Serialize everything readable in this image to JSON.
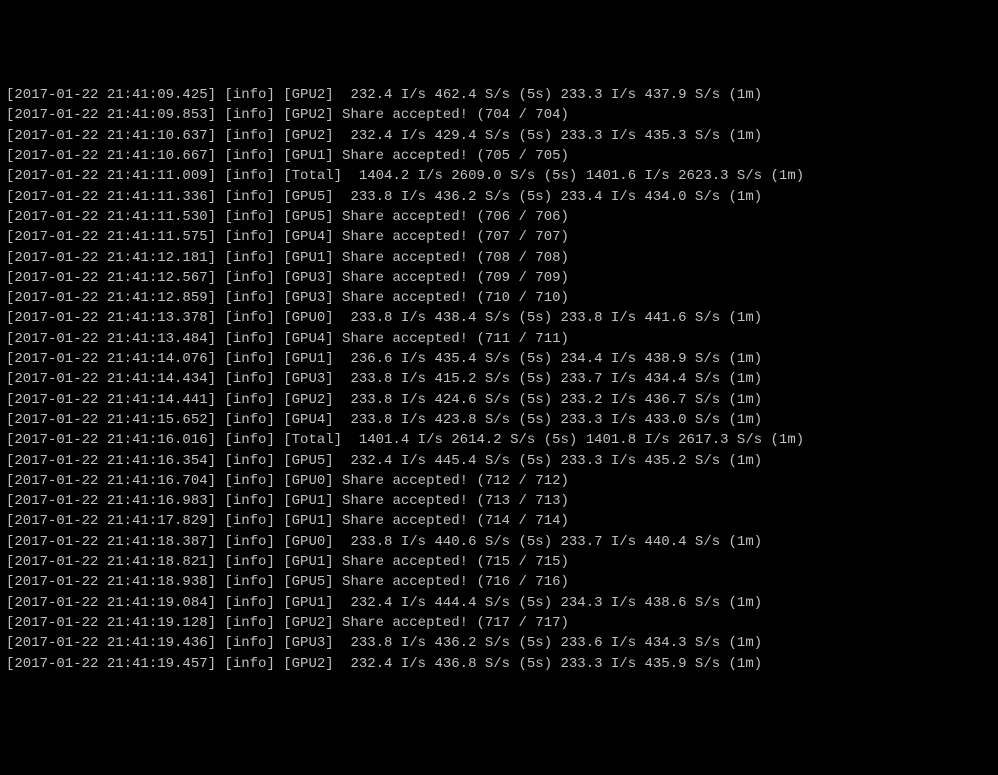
{
  "log_lines": [
    "[2017-01-22 21:41:09.425] [info] [GPU2]  232.4 I/s 462.4 S/s (5s) 233.3 I/s 437.9 S/s (1m)",
    "[2017-01-22 21:41:09.853] [info] [GPU2] Share accepted! (704 / 704)",
    "[2017-01-22 21:41:10.637] [info] [GPU2]  232.4 I/s 429.4 S/s (5s) 233.3 I/s 435.3 S/s (1m)",
    "[2017-01-22 21:41:10.667] [info] [GPU1] Share accepted! (705 / 705)",
    "[2017-01-22 21:41:11.009] [info] [Total]  1404.2 I/s 2609.0 S/s (5s) 1401.6 I/s 2623.3 S/s (1m)",
    "[2017-01-22 21:41:11.336] [info] [GPU5]  233.8 I/s 436.2 S/s (5s) 233.4 I/s 434.0 S/s (1m)",
    "[2017-01-22 21:41:11.530] [info] [GPU5] Share accepted! (706 / 706)",
    "[2017-01-22 21:41:11.575] [info] [GPU4] Share accepted! (707 / 707)",
    "[2017-01-22 21:41:12.181] [info] [GPU1] Share accepted! (708 / 708)",
    "[2017-01-22 21:41:12.567] [info] [GPU3] Share accepted! (709 / 709)",
    "[2017-01-22 21:41:12.859] [info] [GPU3] Share accepted! (710 / 710)",
    "[2017-01-22 21:41:13.378] [info] [GPU0]  233.8 I/s 438.4 S/s (5s) 233.8 I/s 441.6 S/s (1m)",
    "[2017-01-22 21:41:13.484] [info] [GPU4] Share accepted! (711 / 711)",
    "[2017-01-22 21:41:14.076] [info] [GPU1]  236.6 I/s 435.4 S/s (5s) 234.4 I/s 438.9 S/s (1m)",
    "[2017-01-22 21:41:14.434] [info] [GPU3]  233.8 I/s 415.2 S/s (5s) 233.7 I/s 434.4 S/s (1m)",
    "[2017-01-22 21:41:14.441] [info] [GPU2]  233.8 I/s 424.6 S/s (5s) 233.2 I/s 436.7 S/s (1m)",
    "[2017-01-22 21:41:15.652] [info] [GPU4]  233.8 I/s 423.8 S/s (5s) 233.3 I/s 433.0 S/s (1m)",
    "[2017-01-22 21:41:16.016] [info] [Total]  1401.4 I/s 2614.2 S/s (5s) 1401.8 I/s 2617.3 S/s (1m)",
    "[2017-01-22 21:41:16.354] [info] [GPU5]  232.4 I/s 445.4 S/s (5s) 233.3 I/s 435.2 S/s (1m)",
    "[2017-01-22 21:41:16.704] [info] [GPU0] Share accepted! (712 / 712)",
    "[2017-01-22 21:41:16.983] [info] [GPU1] Share accepted! (713 / 713)",
    "[2017-01-22 21:41:17.829] [info] [GPU1] Share accepted! (714 / 714)",
    "[2017-01-22 21:41:18.387] [info] [GPU0]  233.8 I/s 440.6 S/s (5s) 233.7 I/s 440.4 S/s (1m)",
    "[2017-01-22 21:41:18.821] [info] [GPU1] Share accepted! (715 / 715)",
    "[2017-01-22 21:41:18.938] [info] [GPU5] Share accepted! (716 / 716)",
    "[2017-01-22 21:41:19.084] [info] [GPU1]  232.4 I/s 444.4 S/s (5s) 234.3 I/s 438.6 S/s (1m)",
    "[2017-01-22 21:41:19.128] [info] [GPU2] Share accepted! (717 / 717)",
    "[2017-01-22 21:41:19.436] [info] [GPU3]  233.8 I/s 436.2 S/s (5s) 233.6 I/s 434.3 S/s (1m)",
    "[2017-01-22 21:41:19.457] [info] [GPU2]  232.4 I/s 436.8 S/s (5s) 233.3 I/s 435.9 S/s (1m)"
  ]
}
